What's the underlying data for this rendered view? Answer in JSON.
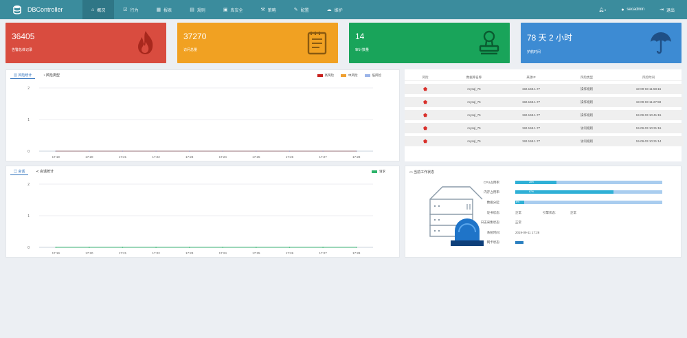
{
  "app": {
    "title": "DBController"
  },
  "nav": [
    {
      "label": "概况",
      "icon": "home-icon",
      "glyph": "⌂"
    },
    {
      "label": "行为",
      "icon": "check-icon",
      "glyph": "☑"
    },
    {
      "label": "报表",
      "icon": "calendar-icon",
      "glyph": "▦"
    },
    {
      "label": "规则",
      "icon": "rules-icon",
      "glyph": "▤"
    },
    {
      "label": "库安全",
      "icon": "db-security-icon",
      "glyph": "▣"
    },
    {
      "label": "策略",
      "icon": "wrench-icon",
      "glyph": "⚒"
    },
    {
      "label": "配置",
      "icon": "tool-icon",
      "glyph": "✎"
    },
    {
      "label": "维护",
      "icon": "cloud-icon",
      "glyph": "☁"
    }
  ],
  "topbar": {
    "bell_count": "0",
    "user": "secadmin",
    "logout": "退出"
  },
  "cards": [
    {
      "value": "36405",
      "label": "告警总体记录",
      "color": "#d94c3f",
      "icon": "fire-icon"
    },
    {
      "value": "37270",
      "label": "访问总量",
      "color": "#f1a122",
      "icon": "document-icon"
    },
    {
      "value": "14",
      "label": "审计数量",
      "color": "#19a45a",
      "icon": "stamp-icon"
    },
    {
      "value": "78 天 2 小时",
      "label": "护航时间",
      "color": "#3d8bd3",
      "icon": "umbrella-icon"
    }
  ],
  "risk_panel": {
    "tabs": [
      "风险统计",
      "风险类型"
    ],
    "legend": [
      {
        "label": "高风险",
        "color": "#c8211e"
      },
      {
        "label": "中风险",
        "color": "#f0a030"
      },
      {
        "label": "低风险",
        "color": "#9bb4e8"
      }
    ]
  },
  "session_panel": {
    "tabs": [
      "会话",
      "会话统计"
    ],
    "legend": [
      {
        "label": "请求",
        "color": "#2db36a"
      }
    ]
  },
  "chart_data": [
    {
      "type": "line",
      "x": [
        "17:19",
        "17:20",
        "17:21",
        "17:22",
        "17:23",
        "17:24",
        "17:25",
        "17:26",
        "17:27",
        "17:28"
      ],
      "series": [
        {
          "name": "高风险",
          "color": "#c8211e",
          "values": [
            0,
            0,
            0,
            0,
            0,
            0,
            0,
            0,
            0,
            0
          ]
        },
        {
          "name": "中风险",
          "color": "#f0a030",
          "values": [
            0,
            0,
            0,
            0,
            0,
            0,
            0,
            0,
            0,
            0
          ]
        },
        {
          "name": "低风险",
          "color": "#9bb4e8",
          "values": [
            0,
            0,
            0,
            0,
            0,
            0,
            0,
            0,
            0,
            0
          ]
        }
      ],
      "yticks": [
        "0",
        "1",
        "2"
      ],
      "ylim": [
        0,
        2
      ],
      "grid": true,
      "legend": "top-right"
    },
    {
      "type": "line",
      "x": [
        "17:19",
        "17:20",
        "17:21",
        "17:22",
        "17:23",
        "17:24",
        "17:25",
        "17:26",
        "17:27",
        "17:28"
      ],
      "series": [
        {
          "name": "请求",
          "color": "#2db36a",
          "values": [
            0,
            0,
            0,
            0,
            0,
            0,
            0,
            0,
            0,
            0
          ]
        }
      ],
      "yticks": [
        "0",
        "1",
        "2"
      ],
      "ylim": [
        0,
        2
      ],
      "grid": true,
      "legend": "top-right"
    }
  ],
  "risk_table": {
    "headers": [
      "风险",
      "数据库名称",
      "来源IP",
      "风险类型",
      "风险时间"
    ],
    "rows": [
      [
        "mysql_75",
        "192.168.1.77",
        "操作规则",
        "19-09-03 11:58:16"
      ],
      [
        "mysql_75",
        "192.168.1.77",
        "操作规则",
        "19-09-03 11:27:59"
      ],
      [
        "mysql_75",
        "192.168.1.77",
        "操作规则",
        "19-09-03 10:41:15"
      ],
      [
        "mysql_75",
        "192.168.1.77",
        "访问规则",
        "19-09-03 10:31:16"
      ],
      [
        "mysql_75",
        "192.168.1.77",
        "访问规则",
        "19-09-03 10:31:14"
      ]
    ]
  },
  "status": {
    "title": "当前工作状态",
    "cpu_label": "CPU占用率:",
    "cpu_value": 28,
    "cpu_text": "28%",
    "mem_label": "内存占用率:",
    "mem_value": 67,
    "mem_text": "67%",
    "disk_label": "数据分区:",
    "disk_value": 6,
    "disk_text": "6%",
    "audit_label": "证书状态:",
    "audit_value": "正常",
    "engine_label": "引擎状态:",
    "engine_value": "正常",
    "collect_label": "日志采集状态:",
    "collect_value": "正常",
    "time_label": "系统时间:",
    "time_value": "2019-09-11 17:28",
    "net_label": "网卡状态:"
  }
}
